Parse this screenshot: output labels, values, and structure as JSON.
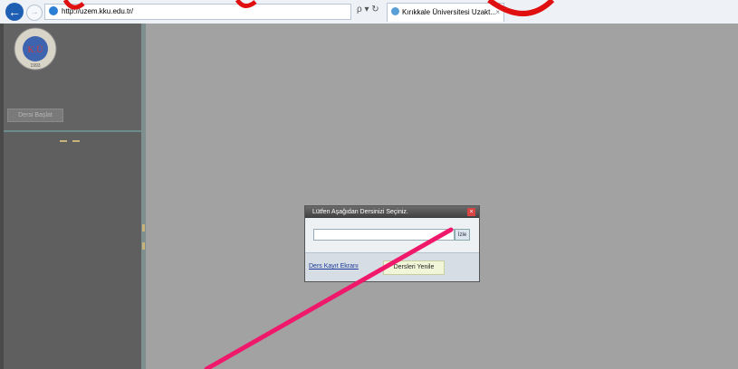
{
  "browser": {
    "address": "http://uzem.kku.edu.tr/",
    "tab_title": "Kırıkkale Üniversitesi Uzakt...",
    "tab_close": "×",
    "back": "←",
    "forward": "→",
    "addr_icons": "ρ ▾ ↻"
  },
  "sidebar": {
    "logo_text": "K.Ü",
    "logo_ring_text": "KIRIKKALE ÜNİVERSİTESİ",
    "logo_year": "1993",
    "start_button": "Dersi Başlat"
  },
  "dialog": {
    "title": "Lütfen Aşağıdan Dersinizi Seçiniz.",
    "close": "×",
    "input_value": "",
    "show_button": "İzle",
    "register_link": "Ders Kayıt Ekranı",
    "refresh_button": "Dersleri Yenile"
  },
  "annotation_color": "#f0186a"
}
